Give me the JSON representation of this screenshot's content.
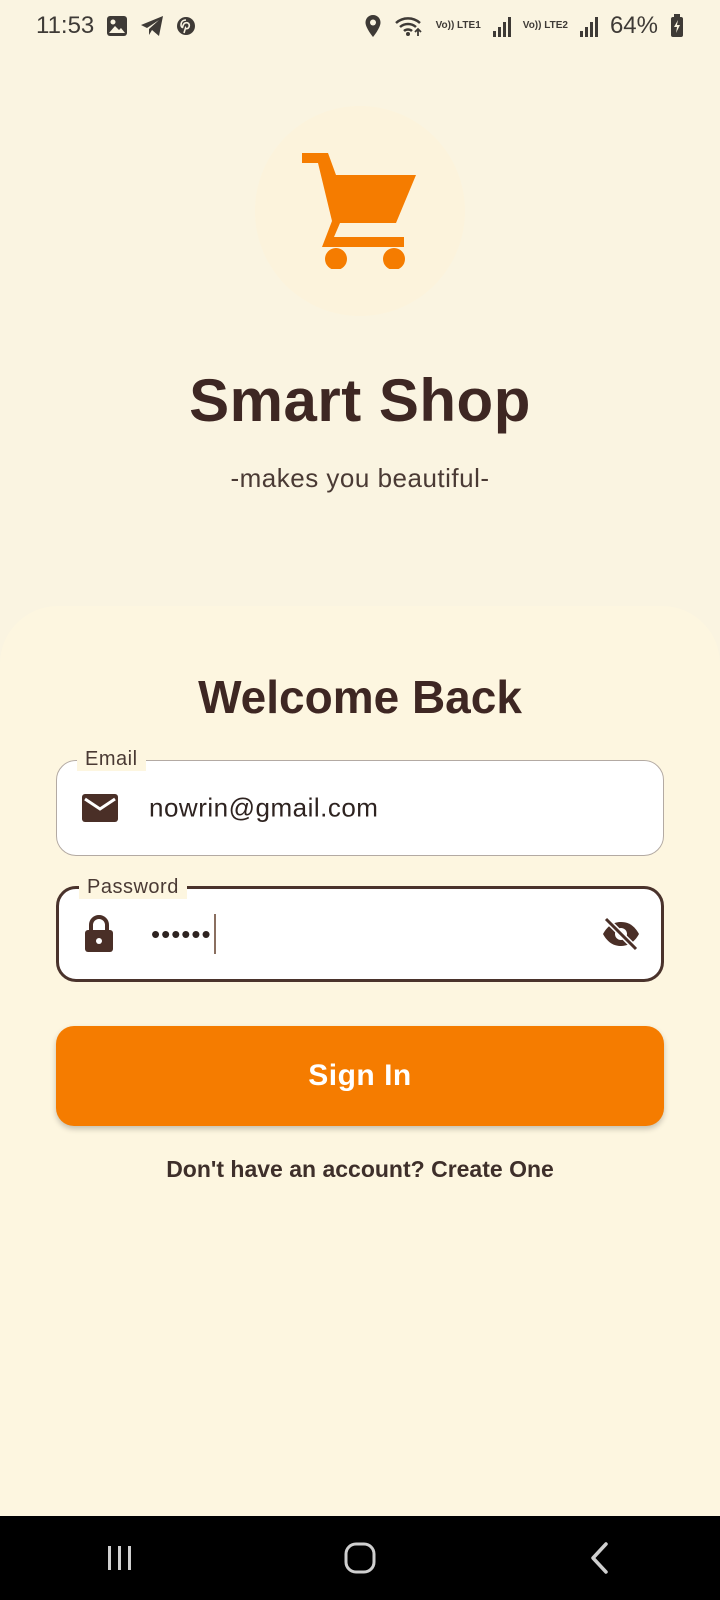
{
  "status_bar": {
    "time": "11:53",
    "network_1": "Vo)) LTE1",
    "network_2": "Vo)) LTE2",
    "battery": "64%",
    "icons": [
      "gallery-icon",
      "telegram-icon",
      "pinterest-icon",
      "location-icon",
      "wifi-icon",
      "signal-icon",
      "battery-icon"
    ]
  },
  "app": {
    "title": "Smart Shop",
    "tagline": "-makes you beautiful-",
    "logo_icon": "shopping-cart-icon"
  },
  "form": {
    "heading": "Welcome Back",
    "email": {
      "label": "Email",
      "value": "nowrin@gmail.com",
      "icon": "mail-icon"
    },
    "password": {
      "label": "Password",
      "value": "••••••",
      "icon": "lock-icon",
      "toggle_icon": "visibility-off-icon"
    },
    "submit_label": "Sign In",
    "signup_text": "Don't have an account? Create One"
  },
  "colors": {
    "accent": "#f57c00",
    "background": "#faf4e1",
    "card": "#fdf6e0",
    "text_dark": "#3e2723"
  },
  "nav_bar": {
    "buttons": [
      "recents-icon",
      "home-icon",
      "back-icon"
    ]
  }
}
